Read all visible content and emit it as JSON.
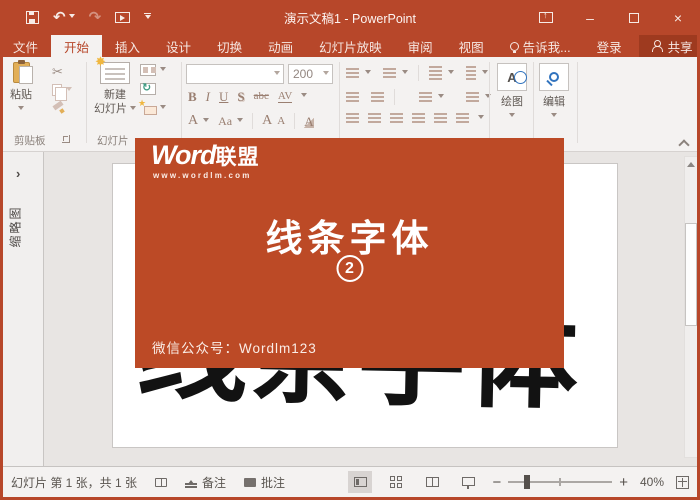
{
  "window": {
    "title": "演示文稿1 - PowerPoint"
  },
  "tabs": [
    {
      "label": "文件"
    },
    {
      "label": "开始"
    },
    {
      "label": "插入"
    },
    {
      "label": "设计"
    },
    {
      "label": "切换"
    },
    {
      "label": "动画"
    },
    {
      "label": "幻灯片放映"
    },
    {
      "label": "审阅"
    },
    {
      "label": "视图"
    },
    {
      "label": "告诉我..."
    },
    {
      "label": "登录"
    },
    {
      "label": "共享"
    }
  ],
  "ribbon": {
    "paste_label": "粘贴",
    "clipboard_group_label": "剪贴板",
    "new_slide_line1": "新建",
    "new_slide_line2": "幻灯片",
    "slides_group_label": "幻灯片",
    "font_name_value": "",
    "font_size_value": "200",
    "bold": "B",
    "italic": "I",
    "underline": "U",
    "shadow": "S",
    "strike": "abc",
    "spacing": "AV",
    "font_color": "A",
    "change_case": "Aa",
    "grow_font": "A",
    "shrink_font": "A",
    "clear_format": "A",
    "draw_label": "绘图",
    "edit_label": "编辑"
  },
  "sidebar": {
    "label": "缩略图",
    "chevron": "›"
  },
  "overlay": {
    "brand_word": "Word",
    "brand_cn": "联盟",
    "url": "www.wordlm.com",
    "title": "线条字体",
    "number": "2",
    "footer": "微信公众号：Wordlm123",
    "bg_color": "#BC4A26"
  },
  "slide": {
    "big_text": "线条字体"
  },
  "statusbar": {
    "slide_info": "幻灯片 第 1 张，共 1 张",
    "notes_label": "备注",
    "comments_label": "批注",
    "zoom_value": "40%"
  },
  "colors": {
    "titlebar": "#B7472A",
    "share_button": "#9E3A1F",
    "ribbon_bg": "#F4F2F1",
    "workspace_bg": "#E8E5E3"
  }
}
